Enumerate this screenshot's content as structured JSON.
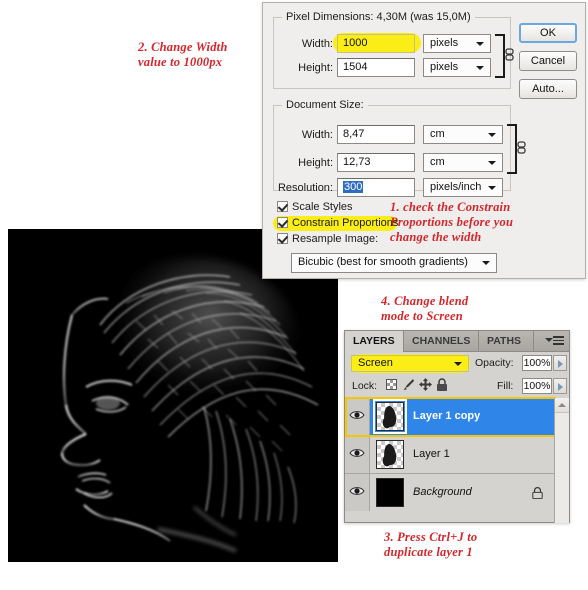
{
  "annotations": [
    {
      "id": "note-width",
      "text": "2. Change Width\nvalue to 1000px"
    },
    {
      "id": "note-constrain",
      "text": "1. check the  Constrain\nProportions before you\nchange the width"
    },
    {
      "id": "note-blend",
      "text": "4. Change blend\nmode to Screen"
    },
    {
      "id": "note-duplicate",
      "text": "3. Press Ctrl+J to\nduplicate layer 1"
    }
  ],
  "dialog": {
    "pixel_dimensions": {
      "group_title": "Pixel Dimensions:  4,30M (was 15,0M)",
      "width_label": "Width:",
      "width_value": "1000",
      "width_unit": "pixels",
      "height_label": "Height:",
      "height_value": "1504",
      "height_unit": "pixels"
    },
    "document_size": {
      "group_title": "Document Size:",
      "width_label": "Width:",
      "width_value": "8,47",
      "width_unit": "cm",
      "height_label": "Height:",
      "height_value": "12,73",
      "height_unit": "cm",
      "resolution_label": "Resolution:",
      "resolution_value": "300",
      "resolution_unit": "pixels/inch"
    },
    "options": {
      "scale_styles": "Scale Styles",
      "constrain_proportions": "Constrain Proportions",
      "resample_image": "Resample Image:",
      "resample_method": "Bicubic (best for smooth gradients)"
    },
    "buttons": {
      "ok": "OK",
      "cancel": "Cancel",
      "auto": "Auto..."
    }
  },
  "layers_panel": {
    "tabs": [
      {
        "label": "LAYERS",
        "active": true
      },
      {
        "label": "CHANNELS",
        "active": false
      },
      {
        "label": "PATHS",
        "active": false
      }
    ],
    "blend_mode": "Screen",
    "opacity_label": "Opacity:",
    "opacity_value": "100%",
    "lock_label": "Lock:",
    "fill_label": "Fill:",
    "fill_value": "100%",
    "layers": [
      {
        "name": "Layer 1 copy",
        "selected": true,
        "locked": false,
        "kind": "transparent"
      },
      {
        "name": "Layer 1",
        "selected": false,
        "locked": false,
        "kind": "transparent"
      },
      {
        "name": "Background",
        "selected": false,
        "locked": true,
        "kind": "black"
      }
    ]
  },
  "colors": {
    "highlight": "#fbee17",
    "annotation": "#d6252b",
    "selection_blue": "#2f86e8",
    "selection_outline": "#f5c700",
    "dialog_bg": "#efeeec",
    "panel_bg": "#d5d3cf"
  }
}
